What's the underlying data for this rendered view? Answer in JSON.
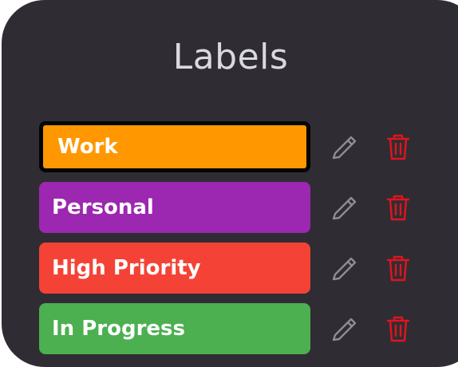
{
  "dialog": {
    "title": "Labels"
  },
  "labels": [
    {
      "name": "Work",
      "color": "#ff9800",
      "selected": true
    },
    {
      "name": "Personal",
      "color": "#9c27b0",
      "selected": false
    },
    {
      "name": "High Priority",
      "color": "#f44336",
      "selected": false
    },
    {
      "name": "In Progress",
      "color": "#4caf50",
      "selected": false
    }
  ],
  "icons": {
    "edit": "pencil-icon",
    "delete": "trash-icon"
  },
  "colors": {
    "background": "#2f2d33",
    "title_text": "#d9d9df",
    "edit_icon": "#8e8c92",
    "delete_icon": "#e0141e",
    "selected_border": "#050505"
  }
}
